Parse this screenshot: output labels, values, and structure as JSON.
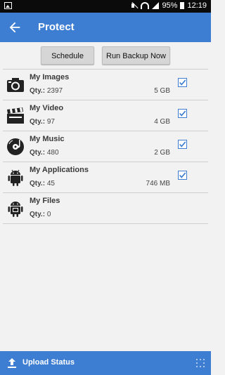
{
  "status_bar": {
    "battery_percent": "95%",
    "time": "12:19"
  },
  "app_bar": {
    "title": "Protect",
    "back_icon": "arrow-left-icon"
  },
  "actions": {
    "schedule_label": "Schedule",
    "run_backup_label": "Run Backup Now"
  },
  "items": [
    {
      "name": "My Images",
      "qty_label": "Qty.:",
      "qty": "2397",
      "size": "5 GB",
      "checked": true,
      "icon": "camera-icon"
    },
    {
      "name": "My Video",
      "qty_label": "Qty.:",
      "qty": "97",
      "size": "4 GB",
      "checked": true,
      "icon": "clapperboard-icon"
    },
    {
      "name": "My Music",
      "qty_label": "Qty.:",
      "qty": "480",
      "size": "2 GB",
      "checked": true,
      "icon": "music-disc-icon"
    },
    {
      "name": "My Applications",
      "qty_label": "Qty.:",
      "qty": "45",
      "size": "746 MB",
      "checked": true,
      "icon": "android-icon"
    },
    {
      "name": "My Files",
      "qty_label": "Qty.:",
      "qty": "0",
      "size": "",
      "checked": false,
      "icon": "android-folder-icon"
    }
  ],
  "bottom_bar": {
    "label": "Upload Status",
    "icon": "upload-icon"
  },
  "colors": {
    "primary": "#3d7ed3",
    "status_bar": "#0b0b0b",
    "background": "#f2f2f2"
  }
}
